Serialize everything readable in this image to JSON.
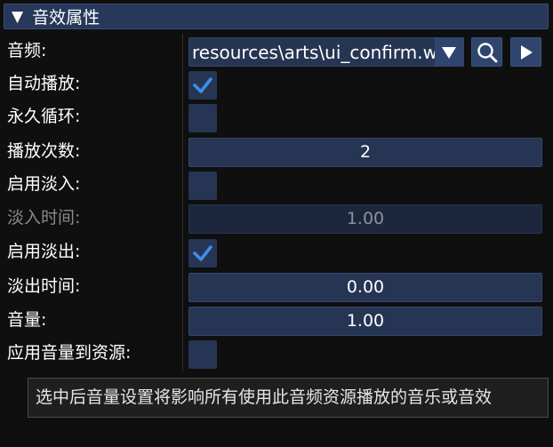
{
  "panel": {
    "title": "音效属性",
    "collapse_icon": "triangle-down-icon"
  },
  "audio": {
    "label": "音频:",
    "value": "resources\\arts\\ui_confirm.w",
    "dropdown_icon": "triangle-down-icon",
    "search_icon": "search-icon",
    "play_icon": "play-icon"
  },
  "autoplay": {
    "label": "自动播放:",
    "checked": true
  },
  "loop": {
    "label": "永久循环:",
    "checked": false
  },
  "play_count": {
    "label": "播放次数:",
    "value": "2"
  },
  "fade_in_enabled": {
    "label": "启用淡入:",
    "checked": false
  },
  "fade_in_time": {
    "label": "淡入时间:",
    "value": "1.00",
    "disabled": true
  },
  "fade_out_enabled": {
    "label": "启用淡出:",
    "checked": true
  },
  "fade_out_time": {
    "label": "淡出时间:",
    "value": "0.00"
  },
  "volume": {
    "label": "音量:",
    "value": "1.00"
  },
  "apply_volume": {
    "label": "应用音量到资源:",
    "checked": false
  },
  "tooltip": {
    "text": "选中后音量设置将影响所有使用此音频资源播放的音乐或音效"
  },
  "colors": {
    "accent_check": "#3e8ee8",
    "field_bg": "#253553",
    "header_bg": "#28385a"
  }
}
